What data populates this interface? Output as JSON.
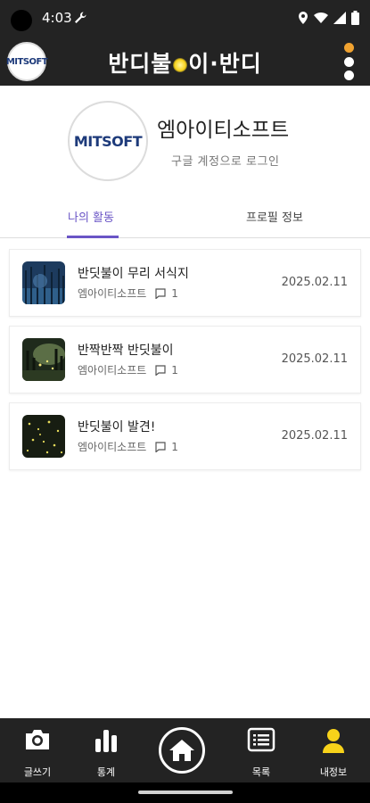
{
  "status_bar": {
    "time": "4:03"
  },
  "header": {
    "title_left": "반디불",
    "title_mid": "이",
    "title_right": "반디",
    "logo_text": "MITSOFT"
  },
  "profile": {
    "name": "엠아이티소프트",
    "login_text": "구글 계정으로 로그인",
    "avatar_text": "MITSOFT"
  },
  "tabs": [
    {
      "label": "나의 활동",
      "active": true
    },
    {
      "label": "프로필 정보",
      "active": false
    }
  ],
  "posts": [
    {
      "title": "반딧불이 무리 서식지",
      "author": "엠아이티소프트",
      "comments": "1",
      "date": "2025.02.11",
      "thumb": "blue-forest"
    },
    {
      "title": "반짝반짝 반딧불이",
      "author": "엠아이티소프트",
      "comments": "1",
      "date": "2025.02.11",
      "thumb": "green-forest"
    },
    {
      "title": "반딧불이 발견!",
      "author": "엠아이티소프트",
      "comments": "1",
      "date": "2025.02.11",
      "thumb": "night-glow"
    }
  ],
  "bottom_nav": [
    {
      "label": "글쓰기",
      "icon": "camera-icon"
    },
    {
      "label": "통계",
      "icon": "bar-chart-icon"
    },
    {
      "label": "",
      "icon": "home-icon"
    },
    {
      "label": "목록",
      "icon": "list-icon"
    },
    {
      "label": "내정보",
      "icon": "user-icon"
    }
  ],
  "colors": {
    "accent": "#6a55c6",
    "bar_bg": "#232323",
    "user_icon": "#f7d21a"
  }
}
